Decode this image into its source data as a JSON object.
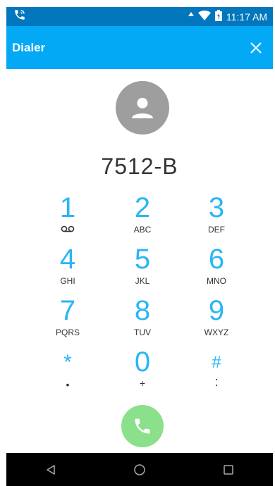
{
  "status_bar": {
    "time": "11:17 AM",
    "icons": [
      "phone-wifi-call-icon",
      "signal-icon",
      "wifi-icon",
      "battery-icon"
    ]
  },
  "app_bar": {
    "title": "Dialer",
    "close_icon": "close-icon"
  },
  "dialer": {
    "number": "7512-B",
    "keys": [
      {
        "digit": "1",
        "sub": ""
      },
      {
        "digit": "2",
        "sub": "ABC"
      },
      {
        "digit": "3",
        "sub": "DEF"
      },
      {
        "digit": "4",
        "sub": "GHI"
      },
      {
        "digit": "5",
        "sub": "JKL"
      },
      {
        "digit": "6",
        "sub": "MNO"
      },
      {
        "digit": "7",
        "sub": "PQRS"
      },
      {
        "digit": "8",
        "sub": "TUV"
      },
      {
        "digit": "9",
        "sub": "WXYZ"
      },
      {
        "digit": "*",
        "sub": "•"
      },
      {
        "digit": "0",
        "sub": "+"
      },
      {
        "digit": "#",
        "sub": ":"
      }
    ]
  },
  "colors": {
    "status_bar": "#0277bd",
    "app_bar": "#03a9f4",
    "accent": "#29b6f6",
    "call_button": "#8be08b",
    "avatar": "#9e9e9e"
  }
}
